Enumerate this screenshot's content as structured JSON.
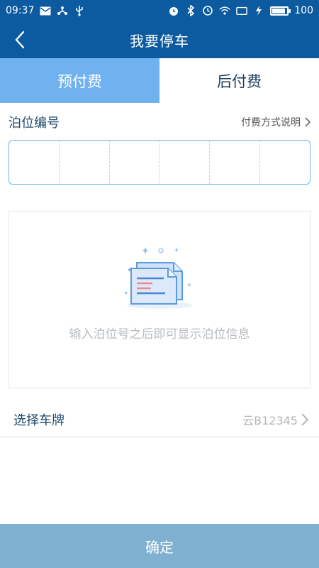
{
  "status_bar": {
    "time": "09:37",
    "battery": "100"
  },
  "nav": {
    "title": "我要停车"
  },
  "tabs": [
    {
      "label": "预付费",
      "active": true
    },
    {
      "label": "后付费",
      "active": false
    }
  ],
  "berth": {
    "label": "泊位编号",
    "payment_note": "付费方式说明",
    "code_cells": 6
  },
  "info_card": {
    "empty_text": "输入泊位号之后即可显示泊位信息"
  },
  "plate": {
    "label": "选择车牌",
    "value": "云B12345"
  },
  "confirm": {
    "label": "确定"
  },
  "colors": {
    "primary": "#0c5ba0",
    "tab_active": "#6fb2ef",
    "confirm_bg": "#80b0d0"
  }
}
